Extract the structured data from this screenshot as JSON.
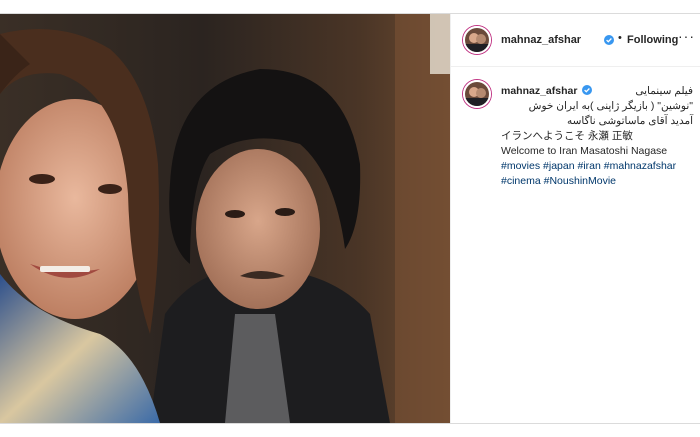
{
  "post": {
    "author": "mahnaz_afshar",
    "dot": "•",
    "follow_state": "Following",
    "more_glyph": "···",
    "caption": {
      "author": "mahnaz_afshar",
      "line1_persian": "فیلم سینمایی",
      "line2_persian": "\"نوشین\" ( بازیگر ژاپنی )به ایران خوش",
      "line3_persian": "آمدید آقای ماساتوشی ناگاسه",
      "line4_japanese": "イランへようこそ 永瀬 正敏",
      "line5_english": "Welcome to Iran Masatoshi Nagase",
      "hashtags_row1": [
        "#movies",
        "#japan",
        "#iran",
        "#mahnazafshar"
      ],
      "hashtags_row2": [
        "#cinema",
        "#NoushinMovie"
      ]
    }
  },
  "colors": {
    "verified_blue": "#3897f0",
    "hashtag_blue": "#00376b",
    "text": "#262626",
    "border": "#dbdbdb"
  },
  "icons": [
    "avatar-image",
    "verified-badge-icon",
    "more-options-icon"
  ]
}
